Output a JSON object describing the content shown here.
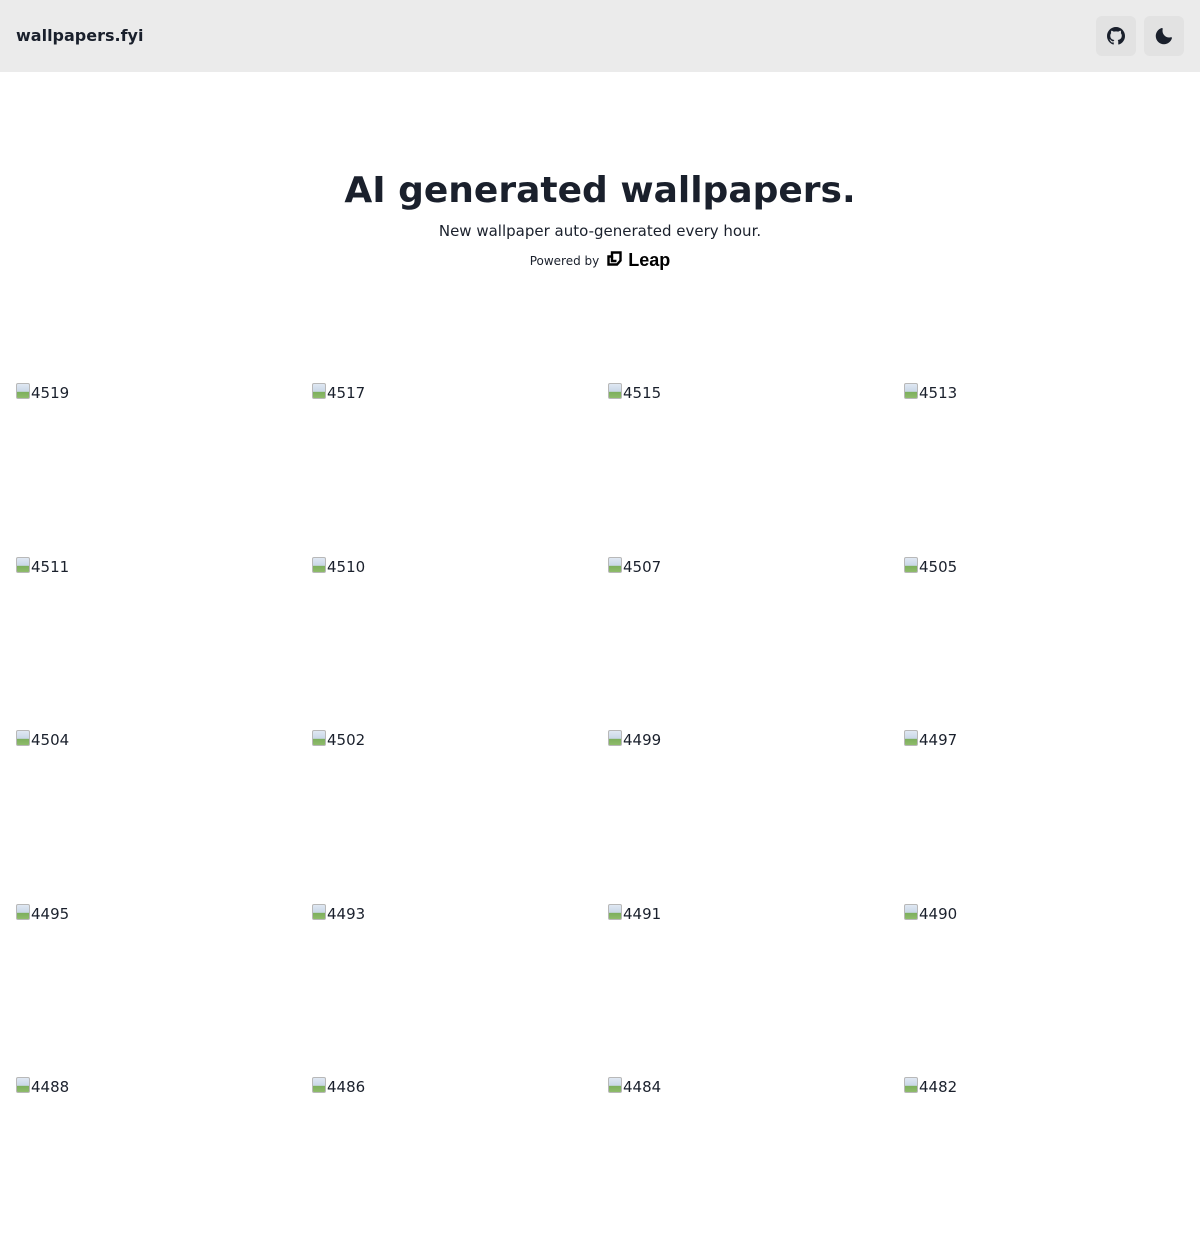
{
  "navbar": {
    "brand": "wallpapers.fyi",
    "github_icon": "github-icon",
    "theme_icon": "moon-icon"
  },
  "hero": {
    "title": "AI generated wallpapers.",
    "subtitle": "New wallpaper auto-generated every hour.",
    "powered_by": "Powered by",
    "leap_name": "Leap"
  },
  "wallpapers": [
    {
      "alt": "4519"
    },
    {
      "alt": "4517"
    },
    {
      "alt": "4515"
    },
    {
      "alt": "4513"
    },
    {
      "alt": "4511"
    },
    {
      "alt": "4510"
    },
    {
      "alt": "4507"
    },
    {
      "alt": "4505"
    },
    {
      "alt": "4504"
    },
    {
      "alt": "4502"
    },
    {
      "alt": "4499"
    },
    {
      "alt": "4497"
    },
    {
      "alt": "4495"
    },
    {
      "alt": "4493"
    },
    {
      "alt": "4491"
    },
    {
      "alt": "4490"
    },
    {
      "alt": "4488"
    },
    {
      "alt": "4486"
    },
    {
      "alt": "4484"
    },
    {
      "alt": "4482"
    }
  ],
  "colors": {
    "navbar_bg": "#ebebeb",
    "text": "#1a202c"
  }
}
